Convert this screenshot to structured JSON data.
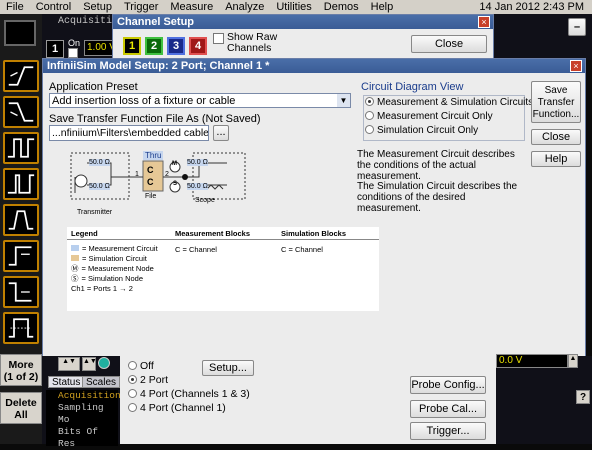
{
  "menu": {
    "items": [
      "File",
      "Control",
      "Setup",
      "Trigger",
      "Measure",
      "Analyze",
      "Utilities",
      "Demos",
      "Help"
    ],
    "datetime": "14 Jan 2012  2:43 PM"
  },
  "scope": {
    "acq_title": "Acquisition i",
    "on_label": "On",
    "volt": "1.00 V",
    "right_volt": "0.0 V",
    "channel_one": "1"
  },
  "sidebar": {
    "more_label": "More",
    "more_sub": "(1 of 2)",
    "delete_label": "Delete",
    "delete_sub": "All"
  },
  "channel_setup": {
    "title": "Channel Setup",
    "channels": [
      "1",
      "2",
      "3",
      "4"
    ],
    "show_raw_label": "Show Raw Channels",
    "close_label": "Close"
  },
  "dialog": {
    "title": "InfiniiSim Model Setup: 2 Port; Channel 1 *",
    "app_preset_label": "Application Preset",
    "app_preset_value": "Add insertion loss of a fixture or cable",
    "save_label": "Save Transfer Function File As (Not Saved)",
    "save_value": "...nfiniium\\Filters\\embedded cable.tf2",
    "browse_label": "...",
    "circuit_view_label": "Circuit Diagram View",
    "circuit_options": [
      "Measurement & Simulation Circuits",
      "Measurement Circuit Only",
      "Simulation Circuit Only"
    ],
    "circuit_selected": 0,
    "desc1": "The Measurement Circuit describes the conditions of the actual measurement.",
    "desc2": "The Simulation Circuit describes the conditions of the desired measurement.",
    "save_tf_button": "Save Transfer Function...",
    "close_button": "Close",
    "help_button": "Help",
    "diagram": {
      "thru": "Thru",
      "block_c": "C",
      "port1": "1",
      "port2": "2",
      "res_top_left": "50.0 Ω",
      "res_bot_left": "50.0 Ω",
      "res_top_right": "50.0 Ω",
      "res_bot_right": "50.0 Ω",
      "node_m": "M",
      "node_s": "S",
      "transmitter": "Transmitter",
      "file": "File",
      "scope": "Scope"
    },
    "legend": {
      "title": "Legend",
      "items": [
        "= Measurement Circuit",
        "= Simulation Circuit",
        "= Measurement Node",
        "= Simulation Node"
      ],
      "ch1_ports": "Ch1 = Ports 1 → 2",
      "mblocks_title": "Measurement Blocks",
      "mblocks_value": "C = Channel",
      "sblocks_title": "Simulation Blocks",
      "sblocks_value": "C = Channel"
    }
  },
  "bottom": {
    "port_options": [
      "Off",
      "2 Port",
      "4 Port  (Channels 1 & 3)",
      "4 Port  (Channel 1)"
    ],
    "port_selected": 1,
    "setup_button": "Setup...",
    "probe_config": "Probe Config...",
    "probe_cal": "Probe Cal...",
    "trigger": "Trigger...",
    "tab_status": "Status",
    "tab_scales": "Scales",
    "term_lines": [
      "Acquisition",
      "Sampling Mo",
      "",
      "Bits Of Res"
    ]
  }
}
